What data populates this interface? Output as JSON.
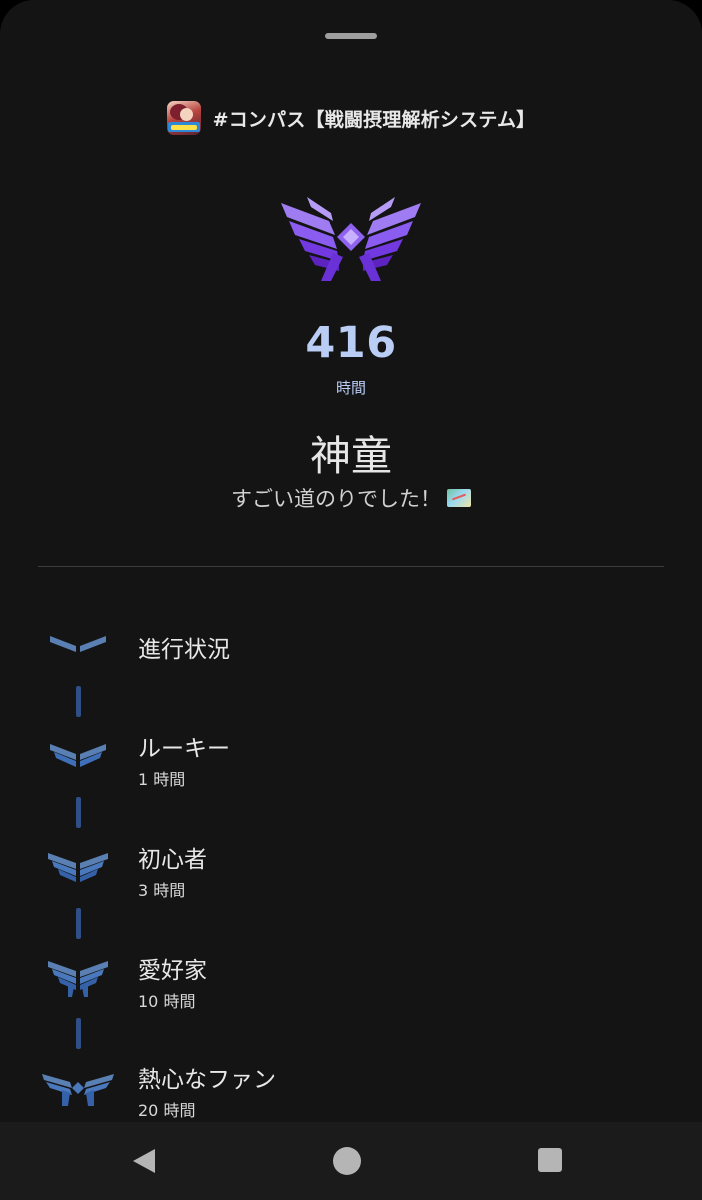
{
  "header": {
    "app_name": "#コンパス【戦闘摂理解析システム】",
    "app_icon": "app-character-icon"
  },
  "achievement": {
    "hours_value": "416",
    "hours_unit": "時間",
    "rank_title": "神童",
    "message": "すごい道のりでした！",
    "message_emoji": "world-map-icon"
  },
  "milestones": [
    {
      "label": "進行状況",
      "sub": ""
    },
    {
      "label": "ルーキー",
      "sub": "1 時間"
    },
    {
      "label": "初心者",
      "sub": "3 時間"
    },
    {
      "label": "愛好家",
      "sub": "10 時間"
    },
    {
      "label": "熱心なファン",
      "sub": "20 時間"
    }
  ],
  "colors": {
    "accent_purple": "#7b3fe4",
    "accent_blue": "#b9cdf5",
    "milestone_blue": "#3f6fb8",
    "background": "#141414"
  },
  "navbar": {
    "back": "back-triangle-icon",
    "home": "home-circle-icon",
    "recents": "recents-square-icon"
  }
}
